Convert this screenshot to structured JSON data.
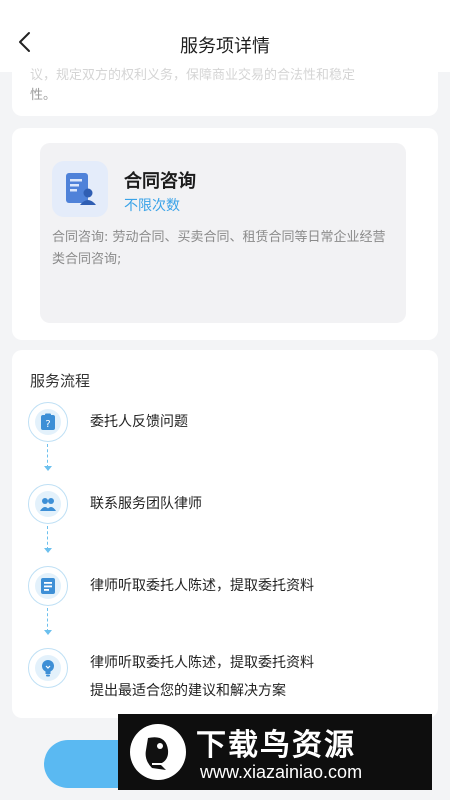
{
  "header": {
    "title": "服务项详情"
  },
  "intro": {
    "line1_partial": "议，规定双方的权利义务，保障商业交易的合法性和稳定",
    "line2": "性。"
  },
  "service": {
    "title": "合同咨询",
    "subtitle": "不限次数",
    "description": "合同咨询: 劳动合同、买卖合同、租赁合同等日常企业经营类合同咨询;",
    "icon": "document-person-icon",
    "accent_color": "#3aa3e8"
  },
  "flow": {
    "title": "服务流程",
    "steps": [
      {
        "text": "委托人反馈问题",
        "icon": "question-clipboard-icon"
      },
      {
        "text": "联系服务团队律师",
        "icon": "people-icon"
      },
      {
        "text": "律师听取委托人陈述，提取委托资料",
        "icon": "document-icon"
      },
      {
        "text": "律师听取委托人陈述，提取委托资料",
        "text2": "提出最适合您的建议和解决方案",
        "icon": "lightbulb-icon"
      }
    ]
  },
  "watermark": {
    "title": "下载鸟资源",
    "url": "www.xiazainiao.com"
  },
  "colors": {
    "primary": "#5ab9f2",
    "line": "#6cc0ee"
  }
}
